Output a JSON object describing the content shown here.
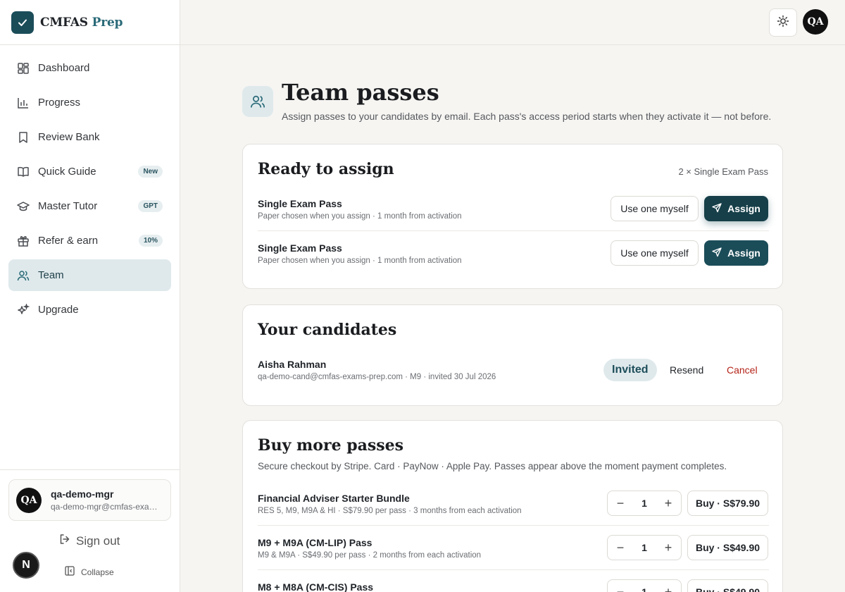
{
  "brand": {
    "name": "CMFAS",
    "name_accent": "Prep"
  },
  "sidebar": {
    "items": [
      {
        "label": "Dashboard",
        "icon": "dashboard-icon"
      },
      {
        "label": "Progress",
        "icon": "bar-chart-icon"
      },
      {
        "label": "Review Bank",
        "icon": "bookmark-icon"
      },
      {
        "label": "Quick Guide",
        "icon": "book-icon",
        "badge": "New"
      },
      {
        "label": "Master Tutor",
        "icon": "graduation-cap-icon",
        "badge": "GPT"
      },
      {
        "label": "Refer & earn",
        "icon": "gift-icon",
        "badge": "10%"
      },
      {
        "label": "Team",
        "icon": "users-icon",
        "active": true
      },
      {
        "label": "Upgrade",
        "icon": "sparkles-icon"
      }
    ],
    "user": {
      "initials": "QA",
      "name": "qa-demo-mgr",
      "email": "qa-demo-mgr@cmfas-exams-prep.com"
    },
    "sign_out": "Sign out",
    "collapse": "Collapse",
    "n_badge": "N"
  },
  "topbar": {
    "avatar_initials": "QA"
  },
  "page": {
    "title": "Team passes",
    "subtitle": "Assign passes to your candidates by email. Each pass's access period starts when they activate it — not before."
  },
  "ready": {
    "title": "Ready to assign",
    "note": "2 × Single Exam Pass",
    "rows": [
      {
        "name": "Single Exam Pass",
        "sub": "Paper chosen when you assign · 1 month from activation",
        "use_label": "Use one myself",
        "assign_label": "Assign"
      },
      {
        "name": "Single Exam Pass",
        "sub": "Paper chosen when you assign · 1 month from activation",
        "use_label": "Use one myself",
        "assign_label": "Assign"
      }
    ]
  },
  "candidates": {
    "title": "Your candidates",
    "rows": [
      {
        "name": "Aisha Rahman",
        "sub": "qa-demo-cand@cmfas-exams-prep.com · M9 · invited 30 Jul 2026",
        "status": "Invited",
        "resend": "Resend",
        "cancel": "Cancel"
      }
    ]
  },
  "buy": {
    "title": "Buy more passes",
    "subtitle": "Secure checkout by Stripe. Card · PayNow · Apple Pay. Passes appear above the moment payment completes.",
    "rows": [
      {
        "name": "Financial Adviser Starter Bundle",
        "sub": "RES 5, M9, M9A & HI · S$79.90 per pass · 3 months from each activation",
        "qty": "1",
        "buy_label": "Buy · S$79.90"
      },
      {
        "name": "M9 + M9A (CM-LIP) Pass",
        "sub": "M9 & M9A · S$49.90 per pass · 2 months from each activation",
        "qty": "1",
        "buy_label": "Buy · S$49.90"
      },
      {
        "name": "M8 + M8A (CM-CIS) Pass",
        "sub": "",
        "qty": "1",
        "buy_label": "Buy · S$49.90"
      }
    ]
  },
  "colors": {
    "brand": "#1b4d59",
    "active_bg": "#dfe9ec",
    "cancel": "#b42318"
  }
}
